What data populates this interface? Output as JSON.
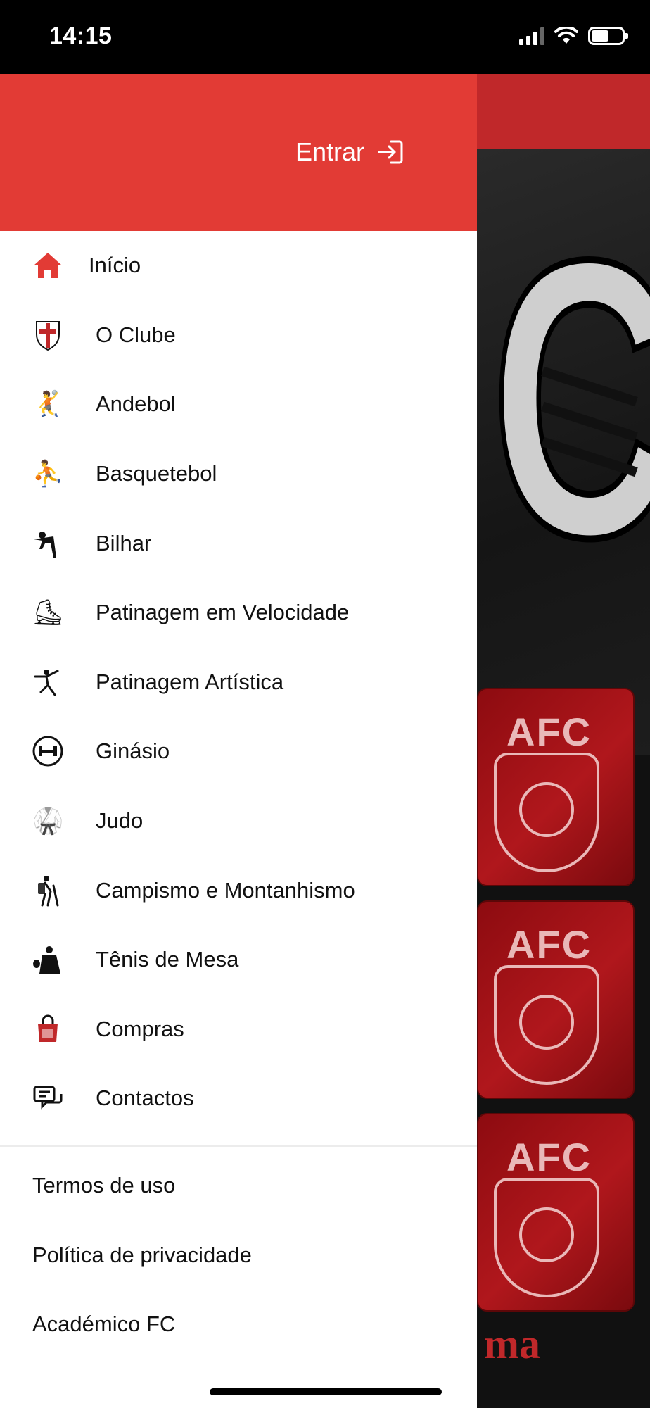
{
  "status_bar": {
    "time": "14:15"
  },
  "drawer": {
    "login_label": "Entrar",
    "menu_items": [
      {
        "label": "Início",
        "icon": "home-icon"
      },
      {
        "label": "O Clube",
        "icon": "club-crest-icon"
      },
      {
        "label": "Andebol",
        "icon": "handball-icon"
      },
      {
        "label": "Basquetebol",
        "icon": "basketball-icon"
      },
      {
        "label": "Bilhar",
        "icon": "billiards-icon"
      },
      {
        "label": "Patinagem em Velocidade",
        "icon": "speed-skating-icon"
      },
      {
        "label": "Patinagem Artística",
        "icon": "figure-skating-icon"
      },
      {
        "label": "Ginásio",
        "icon": "gym-icon"
      },
      {
        "label": "Judo",
        "icon": "judo-icon"
      },
      {
        "label": "Campismo e Montanhismo",
        "icon": "hiking-icon"
      },
      {
        "label": "Tênis de Mesa",
        "icon": "table-tennis-icon"
      },
      {
        "label": "Compras",
        "icon": "shopping-icon"
      },
      {
        "label": "Contactos",
        "icon": "contacts-icon"
      }
    ],
    "footer_links": [
      {
        "label": "Termos de uso"
      },
      {
        "label": "Política de privacidade"
      },
      {
        "label": "Académico FC"
      }
    ]
  },
  "background": {
    "cards": [
      {
        "title": "AFC",
        "emblem": "basketball-icon"
      },
      {
        "title": "AFC",
        "emblem": "roller-skate-icon"
      },
      {
        "title": "AFC",
        "emblem": "mountain-icon"
      }
    ],
    "bottom_text": "ma"
  },
  "colors": {
    "accent": "#e23b35",
    "dark_red": "#a3151a"
  }
}
